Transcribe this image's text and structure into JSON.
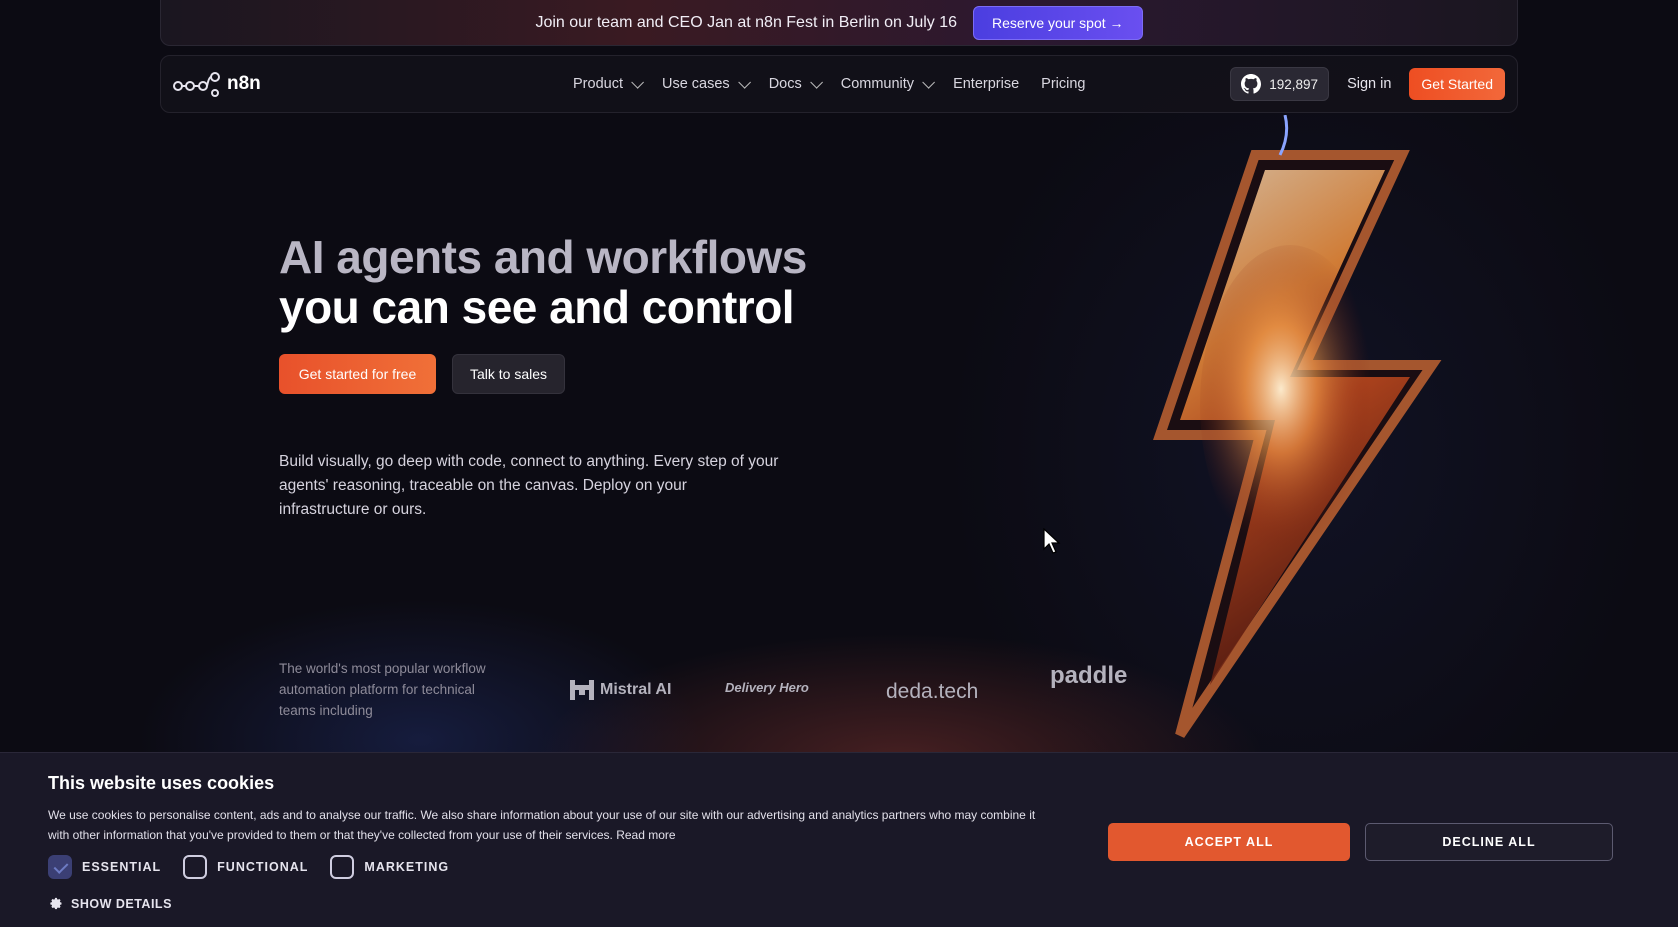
{
  "announcement": {
    "text": "Join our team and CEO Jan at n8n Fest in Berlin on July 16",
    "button_label": "Reserve your spot →"
  },
  "navbar": {
    "logo_text": "n8n",
    "links": [
      {
        "label": "Product",
        "dropdown": true
      },
      {
        "label": "Use cases",
        "dropdown": true
      },
      {
        "label": "Docs",
        "dropdown": true
      },
      {
        "label": "Community",
        "dropdown": true
      },
      {
        "label": "Enterprise",
        "dropdown": false
      },
      {
        "label": "Pricing",
        "dropdown": false
      }
    ],
    "github_stars": "192,897",
    "sign_in_label": "Sign in",
    "get_started_label": "Get Started"
  },
  "hero": {
    "title_line1": "AI agents and workflows",
    "title_line2": "you can see and control",
    "cta_primary": "Get started for free",
    "cta_secondary": "Talk to sales",
    "description": "Build visually, go deep with code, connect to anything. Every step of your agents' reasoning, traceable on the canvas. Deploy on your infrastructure or ours.",
    "trust_text": "The world's most popular workflow automation platform for technical teams including",
    "brands": [
      "Mistral AI",
      "Delivery Hero",
      "deda.tech",
      "paddle"
    ]
  },
  "cookie_banner": {
    "title": "This website uses cookies",
    "body": "We use cookies to personalise content, ads and to analyse our traffic. We also share information about your use of our site with our advertising and analytics partners who may combine it with other information that you've provided to them or that they've collected from your use of their services.",
    "read_more": "Read more",
    "options": [
      {
        "label": "ESSENTIAL",
        "checked": true
      },
      {
        "label": "FUNCTIONAL",
        "checked": false
      },
      {
        "label": "MARKETING",
        "checked": false
      }
    ],
    "show_details": "SHOW DETAILS",
    "accept_label": "ACCEPT ALL",
    "decline_label": "DECLINE ALL"
  },
  "colors": {
    "accent_orange": "#ee4e22",
    "accent_purple": "#5a45e8",
    "background": "#0c0b13"
  }
}
